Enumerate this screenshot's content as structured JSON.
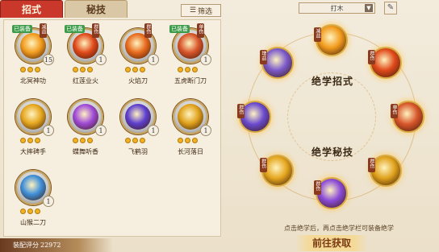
{
  "tabs": [
    {
      "label": "招式"
    },
    {
      "label": "秘技"
    }
  ],
  "filter_label": "筛选",
  "skills": [
    {
      "name": "北冥神功",
      "equipped": "已装备",
      "cat": "减益",
      "level": "15",
      "dots": 3,
      "color": "#f29b1d"
    },
    {
      "name": "红莲业火",
      "equipped": "已装备",
      "cat": "群伤",
      "level": "1",
      "dots": 3,
      "color": "#e0491a"
    },
    {
      "name": "火焰刀",
      "equipped": "",
      "cat": "群伤",
      "level": "1",
      "dots": 3,
      "color": "#e86a1c"
    },
    {
      "name": "五虎断门刀",
      "equipped": "已装备",
      "cat": "单伤",
      "level": "1",
      "dots": 3,
      "color": "#d8552a"
    },
    {
      "name": "大摔碑手",
      "equipped": "",
      "cat": "",
      "level": "1",
      "dots": 3,
      "color": "#e6a71f"
    },
    {
      "name": "蝶舞听香",
      "equipped": "",
      "cat": "",
      "level": "1",
      "dots": 3,
      "color": "#a04ad8"
    },
    {
      "name": "飞鹤羽",
      "equipped": "",
      "cat": "",
      "level": "1",
      "dots": 3,
      "color": "#5e3fcf"
    },
    {
      "name": "长河落日",
      "equipped": "",
      "cat": "",
      "level": "1",
      "dots": 3,
      "color": "#e0a21c"
    },
    {
      "name": "山猴二刀",
      "equipped": "",
      "cat": "",
      "level": "1",
      "dots": 3,
      "color": "#3f8fd8"
    }
  ],
  "score_label": "装配评分",
  "score_value": "22972",
  "dropdown": "打木",
  "wheel_title_top": "绝学招式",
  "wheel_title_bottom": "绝学秘技",
  "slots": [
    {
      "cat": "减益",
      "color": "#f29b1d"
    },
    {
      "cat": "群伤",
      "color": "#e0491a"
    },
    {
      "cat": "单伤",
      "color": "#d8552a"
    },
    {
      "cat": "群伤",
      "color": "#e0a21c"
    },
    {
      "cat": "群伤",
      "color": "#8a4ad8"
    },
    {
      "cat": "群伤",
      "color": "#e6a71f"
    },
    {
      "cat": "群伤",
      "color": "#6a4acf"
    },
    {
      "cat": "增益",
      "color": "#7b5acb"
    }
  ],
  "hint": "点击绝学后，再点击绝学栏可装备绝学",
  "go_button": "前往获取"
}
